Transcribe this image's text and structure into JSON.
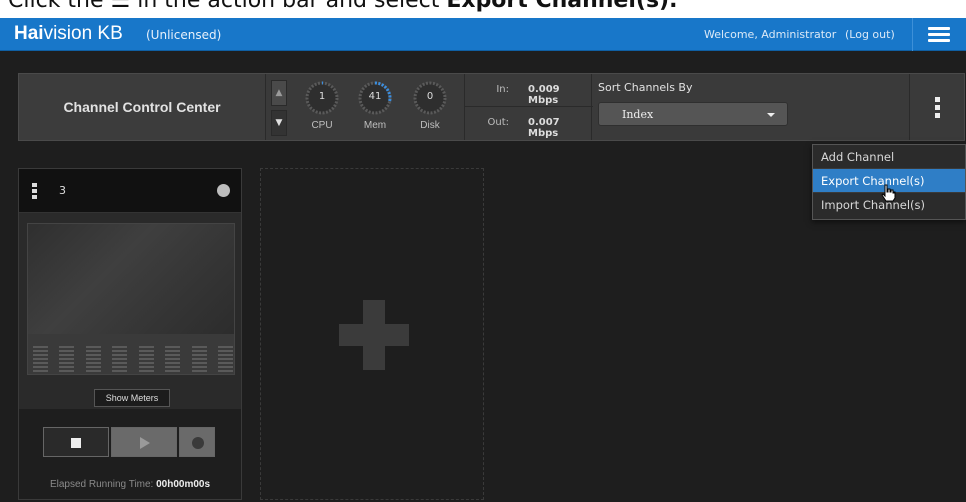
{
  "instruction": {
    "text_a": "Click the",
    "text_b": "in the action bar and select",
    "text_c": "Export Channel(s)."
  },
  "header": {
    "brand_bold": "Hai",
    "brand_rest": "vision KB",
    "license": "(Unlicensed)",
    "welcome": "Welcome, Administrator",
    "logout": "(Log out)"
  },
  "actionbar": {
    "title": "Channel Control Center",
    "gauges": [
      {
        "label": "CPU",
        "value": "1"
      },
      {
        "label": "Mem",
        "value": "41"
      },
      {
        "label": "Disk",
        "value": "0"
      }
    ],
    "bandwidth": {
      "in_label": "In:",
      "in_value": "0.009 Mbps",
      "out_label": "Out:",
      "out_value": "0.007 Mbps"
    },
    "sort_label": "Sort Channels By",
    "sort_value": "Index"
  },
  "menu": {
    "items": [
      "Add Channel",
      "Export Channel(s)",
      "Import Channel(s)"
    ],
    "active_index": 1
  },
  "channel": {
    "number": "3",
    "show_meters": "Show Meters",
    "elapsed_label": "Elapsed Running Time:",
    "elapsed_value": "00h00m00s"
  },
  "colors": {
    "header_bg": "#1877c9",
    "menu_active": "#2f7ec6",
    "gauge_mem": "#3a8ee0"
  }
}
